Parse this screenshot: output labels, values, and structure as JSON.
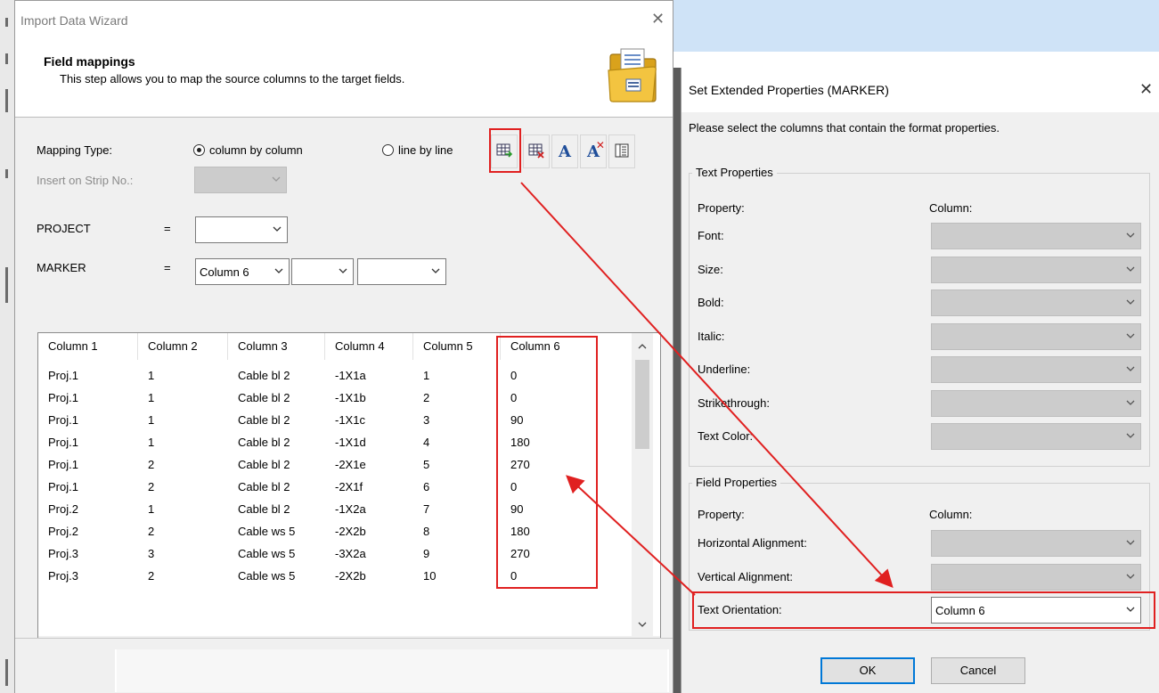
{
  "wizard": {
    "title": "Import Data Wizard",
    "header_title": "Field mappings",
    "header_desc": "This step allows you to map the source columns to the target fields.",
    "mapping_type_label": "Mapping Type:",
    "radio_column": "column by column",
    "radio_line": "line by line",
    "radio_selected": "column by column",
    "insert_strip_label": "Insert on Strip No.:",
    "project_label": "PROJECT",
    "project_eq": "=",
    "project_value": "",
    "marker_label": "MARKER",
    "marker_eq": "=",
    "marker_value_1": "Column 6",
    "marker_value_2": "",
    "marker_value_3": "",
    "toolbar_icons": [
      "extended-properties-icon",
      "remove-properties-icon",
      "text-format-icon",
      "clear-text-format-icon",
      "list-view-icon"
    ],
    "grid": {
      "columns": [
        "Column 1",
        "Column 2",
        "Column 3",
        "Column 4",
        "Column 5",
        "Column 6"
      ],
      "rows": [
        [
          "Proj.1",
          "1",
          "Cable bl 2",
          "-1X1a",
          "1",
          "0"
        ],
        [
          "Proj.1",
          "1",
          "Cable bl 2",
          "-1X1b",
          "2",
          "0"
        ],
        [
          "Proj.1",
          "1",
          "Cable bl 2",
          "-1X1c",
          "3",
          "90"
        ],
        [
          "Proj.1",
          "1",
          "Cable bl 2",
          "-1X1d",
          "4",
          "180"
        ],
        [
          "Proj.1",
          "2",
          "Cable bl 2",
          "-2X1e",
          "5",
          "270"
        ],
        [
          "Proj.1",
          "2",
          "Cable bl 2",
          "-2X1f",
          "6",
          "0"
        ],
        [
          "Proj.2",
          "1",
          "Cable bl 2",
          "-1X2a",
          "7",
          "90"
        ],
        [
          "Proj.2",
          "2",
          "Cable ws 5",
          "-2X2b",
          "8",
          "180"
        ],
        [
          "Proj.3",
          "3",
          "Cable ws 5",
          "-3X2a",
          "9",
          "270"
        ],
        [
          "Proj.3",
          "2",
          "Cable ws 5",
          "-2X2b",
          "10",
          "0"
        ]
      ]
    }
  },
  "dialog": {
    "title": "Set Extended Properties (MARKER)",
    "instruction": "Please select the columns that contain the format properties.",
    "text_group_title": "Text Properties",
    "field_group_title": "Field Properties",
    "property_header": "Property:",
    "column_header": "Column:",
    "text_properties": [
      {
        "label": "Font:",
        "value": ""
      },
      {
        "label": "Size:",
        "value": ""
      },
      {
        "label": "Bold:",
        "value": ""
      },
      {
        "label": "Italic:",
        "value": ""
      },
      {
        "label": "Underline:",
        "value": ""
      },
      {
        "label": "Strikethrough:",
        "value": ""
      },
      {
        "label": "Text Color:",
        "value": ""
      }
    ],
    "field_properties": [
      {
        "label": "Horizontal Alignment:",
        "value": ""
      },
      {
        "label": "Vertical Alignment:",
        "value": ""
      },
      {
        "label": "Text Orientation:",
        "value": "Column 6"
      }
    ],
    "ok_label": "OK",
    "cancel_label": "Cancel"
  },
  "colors": {
    "highlight": "#e02020",
    "dialog_bg": "#f0f0f0",
    "default_button_border": "#0078d7"
  }
}
